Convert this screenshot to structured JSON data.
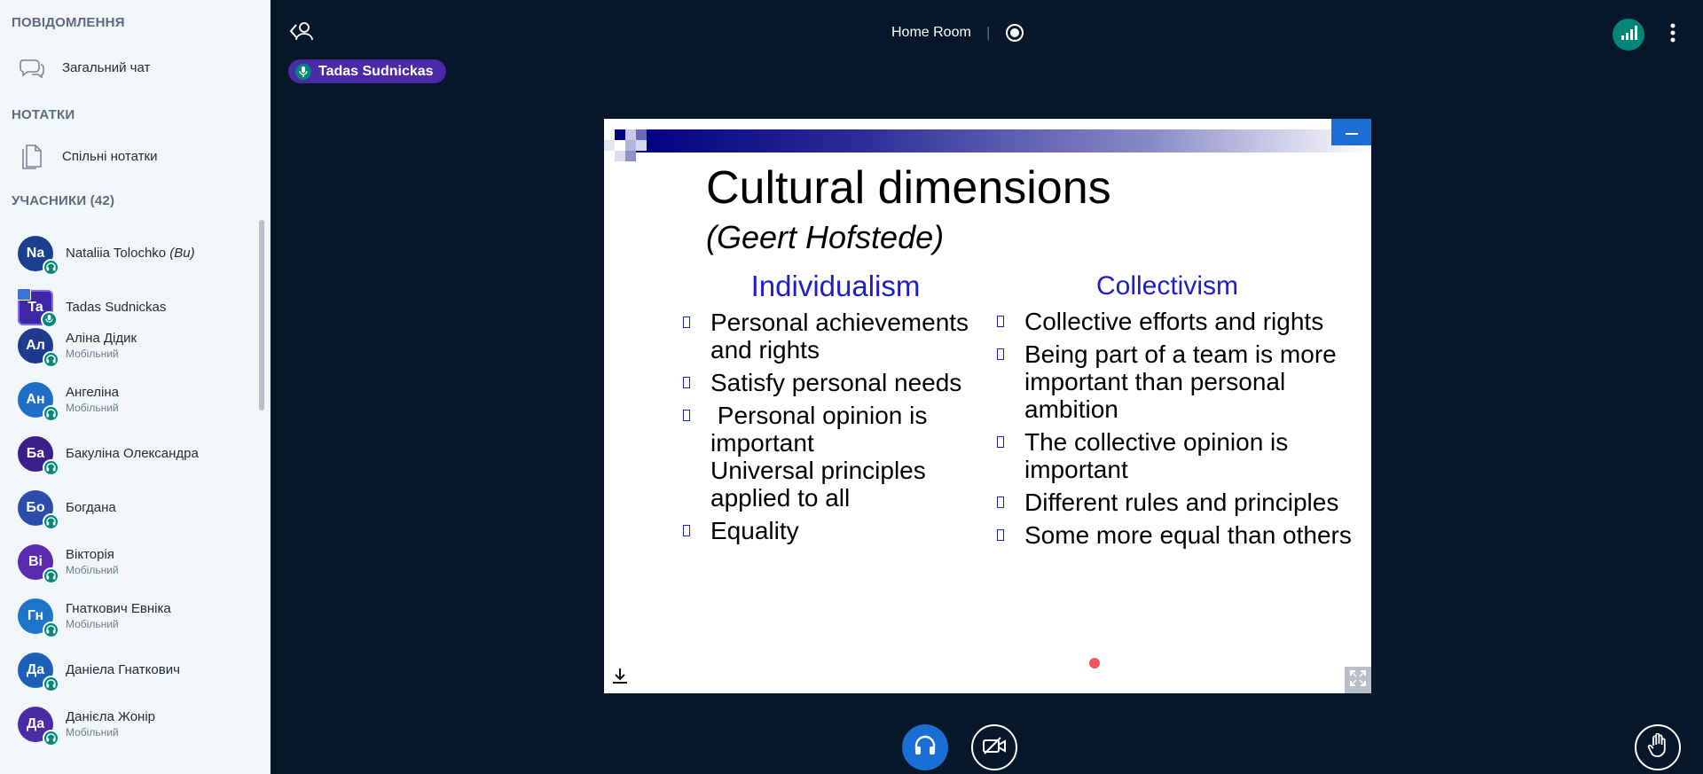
{
  "sidebar": {
    "messages": {
      "header": "ПОВІДОМЛЕННЯ",
      "public_chat": "Загальний чат"
    },
    "notes": {
      "header": "НОТАТКИ",
      "shared_notes": "Спільні нотатки"
    },
    "participants": {
      "header": "УЧАСНИКИ (42)",
      "users": [
        {
          "initials": "Na",
          "name": "Nataliia Tolochko",
          "you": "(Ви)",
          "sub": "",
          "color": "#1a3f8f",
          "status": "headset"
        },
        {
          "initials": "Ta",
          "name": "Tadas Sudnickas",
          "sub": "",
          "color": "#3e27a7",
          "status": "mic",
          "presenter": true
        },
        {
          "initials": "Ал",
          "name": "Аліна Дідик",
          "sub": "Мобільний",
          "color": "#1f3a8c",
          "status": "headset"
        },
        {
          "initials": "Ан",
          "name": "Ангеліна",
          "sub": "Мобільний",
          "color": "#1d6fc7",
          "status": "headset"
        },
        {
          "initials": "Ба",
          "name": "Бакуліна Олександра",
          "sub": "",
          "color": "#3c1e8a",
          "status": "headset"
        },
        {
          "initials": "Бо",
          "name": "Богдана",
          "sub": "",
          "color": "#2d4ba8",
          "status": "headset"
        },
        {
          "initials": "Ві",
          "name": "Вікторія",
          "sub": "Мобільний",
          "color": "#5a2bb0",
          "status": "headset"
        },
        {
          "initials": "Гн",
          "name": "Гнаткович Евніка",
          "sub": "Мобільний",
          "color": "#1d74c8",
          "status": "headset"
        },
        {
          "initials": "Да",
          "name": "Даніела Гнаткович",
          "sub": "",
          "color": "#1d60b8",
          "status": "headset"
        },
        {
          "initials": "Да",
          "name": "Данієла Жонір",
          "sub": "Мобільний",
          "color": "#4a2ba6",
          "status": "headset"
        }
      ]
    }
  },
  "topbar": {
    "room_title": "Home Room",
    "separator": "|"
  },
  "talking_indicator": {
    "name": "Tadas Sudnickas"
  },
  "slide": {
    "title": "Cultural dimensions",
    "subtitle": "(Geert Hofstede)",
    "columns": [
      {
        "heading": "Individualism",
        "bullets": [
          [
            "Personal achievements",
            "and rights"
          ],
          [
            "Satisfy personal needs"
          ],
          [
            " Personal opinion is",
            "important",
            "Universal principles",
            "applied to all"
          ],
          [
            "Equality"
          ]
        ]
      },
      {
        "heading": "Collectivism",
        "bullets": [
          [
            "Collective efforts and rights"
          ],
          [
            "Being part of a team is more",
            "important than personal",
            "ambition"
          ],
          [
            "The collective opinion is",
            "important"
          ],
          [
            "Different rules and principles"
          ],
          [
            "Some more equal than others"
          ]
        ]
      }
    ]
  },
  "colors": {
    "background": "#06172a",
    "sidebar": "#f3f6f9",
    "accent": "#1b6fd4",
    "status_green": "#00877a",
    "talker": "#4a2aa6"
  },
  "icons": {
    "leave": "user-leave-icon",
    "record": "record-icon",
    "connection": "signal-bars-icon",
    "options": "more-vertical-icon",
    "audio": "headphones-icon",
    "video": "video-off-icon",
    "hand": "raise-hand-icon",
    "download": "download-icon",
    "fullscreen": "fullscreen-icon",
    "minimize": "minimize-icon"
  }
}
